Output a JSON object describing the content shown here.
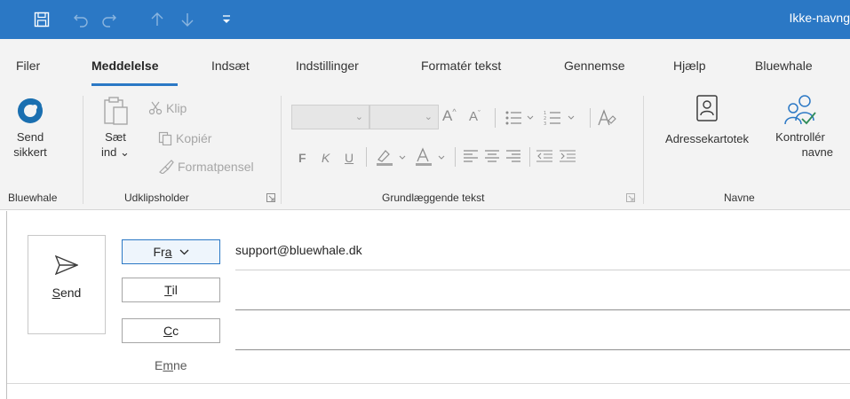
{
  "titlebar": {
    "window_title": "Ikke-navng",
    "qat_icons": [
      "save-icon",
      "undo-icon",
      "redo-icon",
      "up-arrow-icon",
      "down-arrow-icon",
      "customize-qat-icon"
    ],
    "color": "#2b78c5"
  },
  "tabs": [
    "Filer",
    "Meddelelse",
    "Indsæt",
    "Indstillinger",
    "Formatér tekst",
    "Gennemse",
    "Hjælp",
    "Bluewhale"
  ],
  "active_tab": "Meddelelse",
  "ribbon": {
    "bluewhale": {
      "send_secure_line1": "Send",
      "send_secure_line2": "sikkert",
      "group_label": "Bluewhale"
    },
    "clipboard": {
      "paste_line1": "Sæt",
      "paste_line2": "ind",
      "paste_arrow": "⌄",
      "cut": "Klip",
      "copy": "Kopiér",
      "format_painter": "Formatpensel",
      "group_label": "Udklipsholder"
    },
    "basic_text": {
      "grow_font": "A",
      "shrink_font": "A",
      "bold": "F",
      "italic": "K",
      "underline": "U",
      "group_label": "Grundlæggende tekst"
    },
    "names": {
      "address_book": "Adressekartotek",
      "check_names_line1": "Kontrollér",
      "check_names_line2": "navne",
      "group_label": "Navne"
    }
  },
  "compose": {
    "send_label": "Send",
    "send_accel": "S",
    "send_rest": "end",
    "from_label_pre": "Fr",
    "from_label_accel": "a",
    "from_value": "support@bluewhale.dk",
    "to_accel": "T",
    "to_rest": "il",
    "cc_accel": "C",
    "cc_rest": "c",
    "subject_pre": "E",
    "subject_accel": "m",
    "subject_rest": "ne"
  }
}
